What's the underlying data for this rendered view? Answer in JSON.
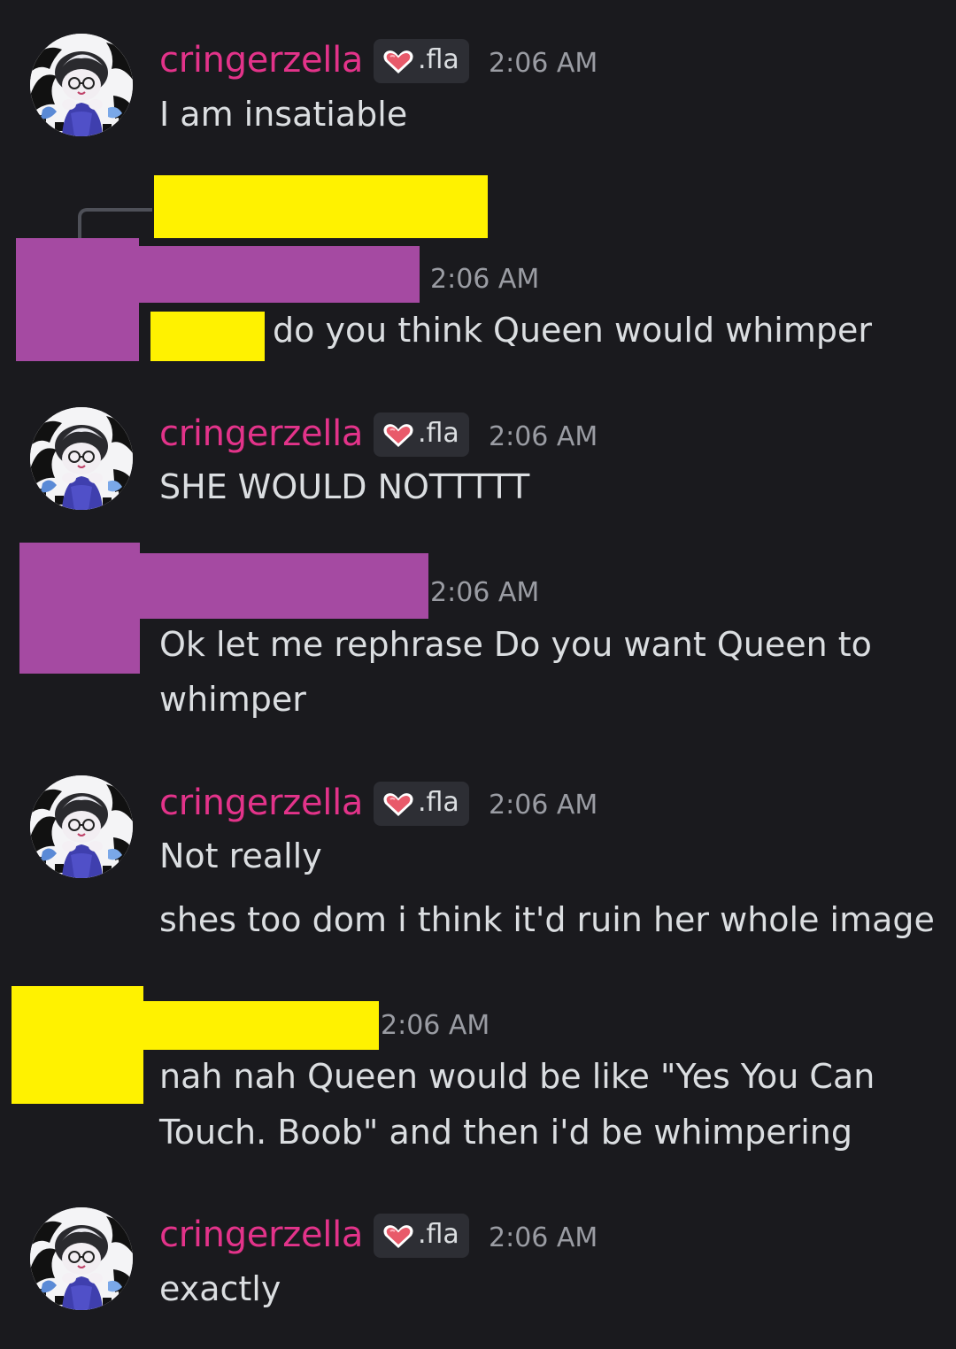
{
  "colors": {
    "background": "#1a1a1e",
    "username": "#e3338a",
    "message_text": "#dbdee1",
    "timestamp": "#9a9ca3",
    "tag_background": "#2d2e34",
    "redaction_purple": "#a54aa2",
    "redaction_yellow": "#fff200"
  },
  "icons": {
    "avatar": "anime-skunk-avatar",
    "tag": "pixel-heart-icon",
    "reply": "reply-connector-line"
  },
  "messages": [
    {
      "username": "cringerzella",
      "tag": ".fla",
      "time": "2:06 AM",
      "lines": [
        "I am insatiable"
      ]
    },
    {
      "username": "",
      "time": "2:06 AM",
      "lines": [
        "do you think Queen would whimper"
      ]
    },
    {
      "username": "cringerzella",
      "tag": ".fla",
      "time": "2:06 AM",
      "lines": [
        "SHE WOULD NOTTTTT"
      ]
    },
    {
      "username": "",
      "time": "2:06 AM",
      "lines": [
        "Ok let me rephrase Do you want Queen to",
        "whimper"
      ]
    },
    {
      "username": "cringerzella",
      "tag": ".fla",
      "time": "2:06 AM",
      "lines": [
        "Not really",
        "shes too dom i think it'd ruin her whole image"
      ]
    },
    {
      "username": "",
      "time": "2:06 AM",
      "lines": [
        "nah nah Queen would be like \"Yes You Can",
        "Touch. Boob\" and then i'd be whimpering"
      ]
    },
    {
      "username": "cringerzella",
      "tag": ".fla",
      "time": "2:06 AM",
      "lines": [
        "exactly"
      ]
    }
  ]
}
